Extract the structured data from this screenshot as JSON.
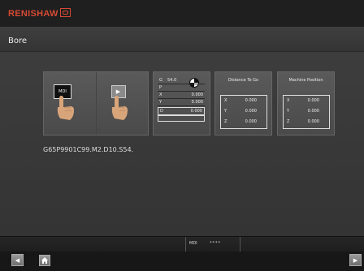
{
  "brand": {
    "name": "RENISHAW"
  },
  "page": {
    "title": "Bore"
  },
  "buttons": {
    "mdi_label": "MDI",
    "play_symbol": "▶"
  },
  "g_panel": {
    "rows": [
      {
        "key": "G",
        "value": "54.0"
      },
      {
        "key": "P",
        "value": ""
      },
      {
        "key": "X",
        "value": "0.000"
      },
      {
        "key": "Y",
        "value": "0.000"
      },
      {
        "key": "D",
        "value": "0.000"
      }
    ]
  },
  "distance_to_go": {
    "title": "Distance To Go",
    "rows": [
      {
        "key": "X",
        "value": "0.000"
      },
      {
        "key": "Y",
        "value": "0.000"
      },
      {
        "key": "Z",
        "value": "0.000"
      }
    ]
  },
  "machine_position": {
    "title": "Machine Position",
    "rows": [
      {
        "key": "X",
        "value": "0.000"
      },
      {
        "key": "Y",
        "value": "0.000"
      },
      {
        "key": "Z",
        "value": "0.000"
      }
    ]
  },
  "gcode": "G65P9901C99.M2.D10.S54.",
  "status": {
    "mode": "MDI",
    "stars": "****"
  },
  "nav": {
    "back": "◀",
    "forward": "▶",
    "home": "⌂"
  },
  "colors": {
    "brand": "#d64a33"
  }
}
